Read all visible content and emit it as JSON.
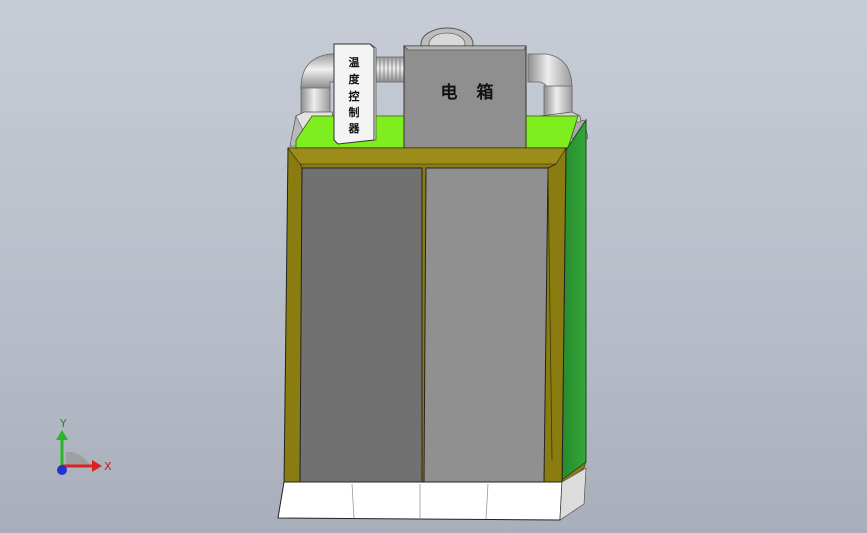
{
  "labels": {
    "temp_controller": [
      "温",
      "度",
      "控",
      "制",
      "器"
    ],
    "electric_box": [
      "电",
      "箱"
    ]
  },
  "triad": {
    "x": "X",
    "y": "Y"
  },
  "colors": {
    "frame_olive": "#8a7c10",
    "door_left": "#717171",
    "door_right": "#909090",
    "side_green": "#2e9a34",
    "top_green": "#7fee1e",
    "box_gray": "#8e8e8e",
    "duct_silver": "#c8c8c8"
  }
}
